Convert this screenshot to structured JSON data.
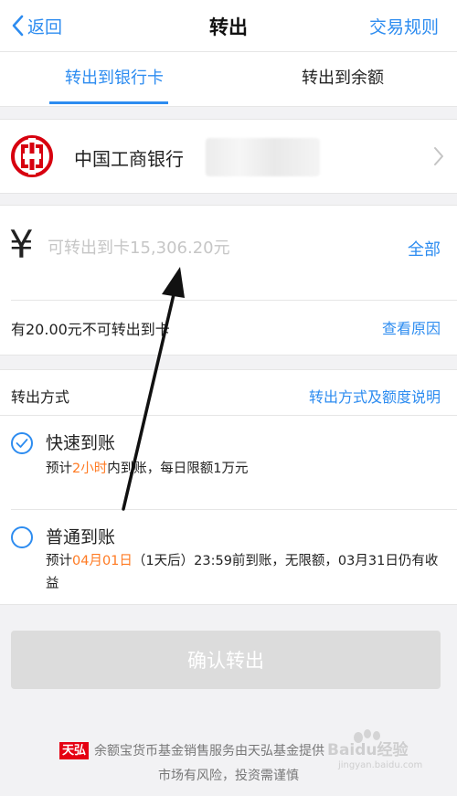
{
  "nav": {
    "back_label": "返回",
    "title": "转出",
    "rules_label": "交易规则"
  },
  "tabs": [
    {
      "label": "转出到银行卡",
      "active": true
    },
    {
      "label": "转出到余额",
      "active": false
    }
  ],
  "bank": {
    "name": "中国工商银行",
    "logo_color": "#d7000f"
  },
  "amount": {
    "currency_symbol": "¥",
    "placeholder": "可转出到卡15,306.20元",
    "all_label": "全部",
    "notice": "有20.00元不可转出到卡",
    "reason_label": "查看原因"
  },
  "method": {
    "label": "转出方式",
    "explain_label": "转出方式及额度说明",
    "options": [
      {
        "title": "快速到账",
        "selected": true,
        "desc_prefix": "预计",
        "desc_highlight": "2小时",
        "desc_suffix": "内到账，每日限额1万元"
      },
      {
        "title": "普通到账",
        "selected": false,
        "desc_prefix": "预计",
        "desc_highlight": "04月01日",
        "desc_suffix": "（1天后）23:59前到账，无限额，03月31日仍有收益"
      }
    ]
  },
  "confirm_label": "确认转出",
  "footer": {
    "logo_text": "天弘",
    "line1": "余额宝货币基金销售服务由天弘基金提供",
    "line2": "市场有风险，投资需谨慎"
  },
  "watermark": {
    "text": "Baidu经验",
    "url": "jingyan.baidu.com"
  },
  "colors": {
    "accent": "#2d8cf0",
    "highlight": "#ff7a22",
    "disabled_button": "#dcdcdc"
  }
}
